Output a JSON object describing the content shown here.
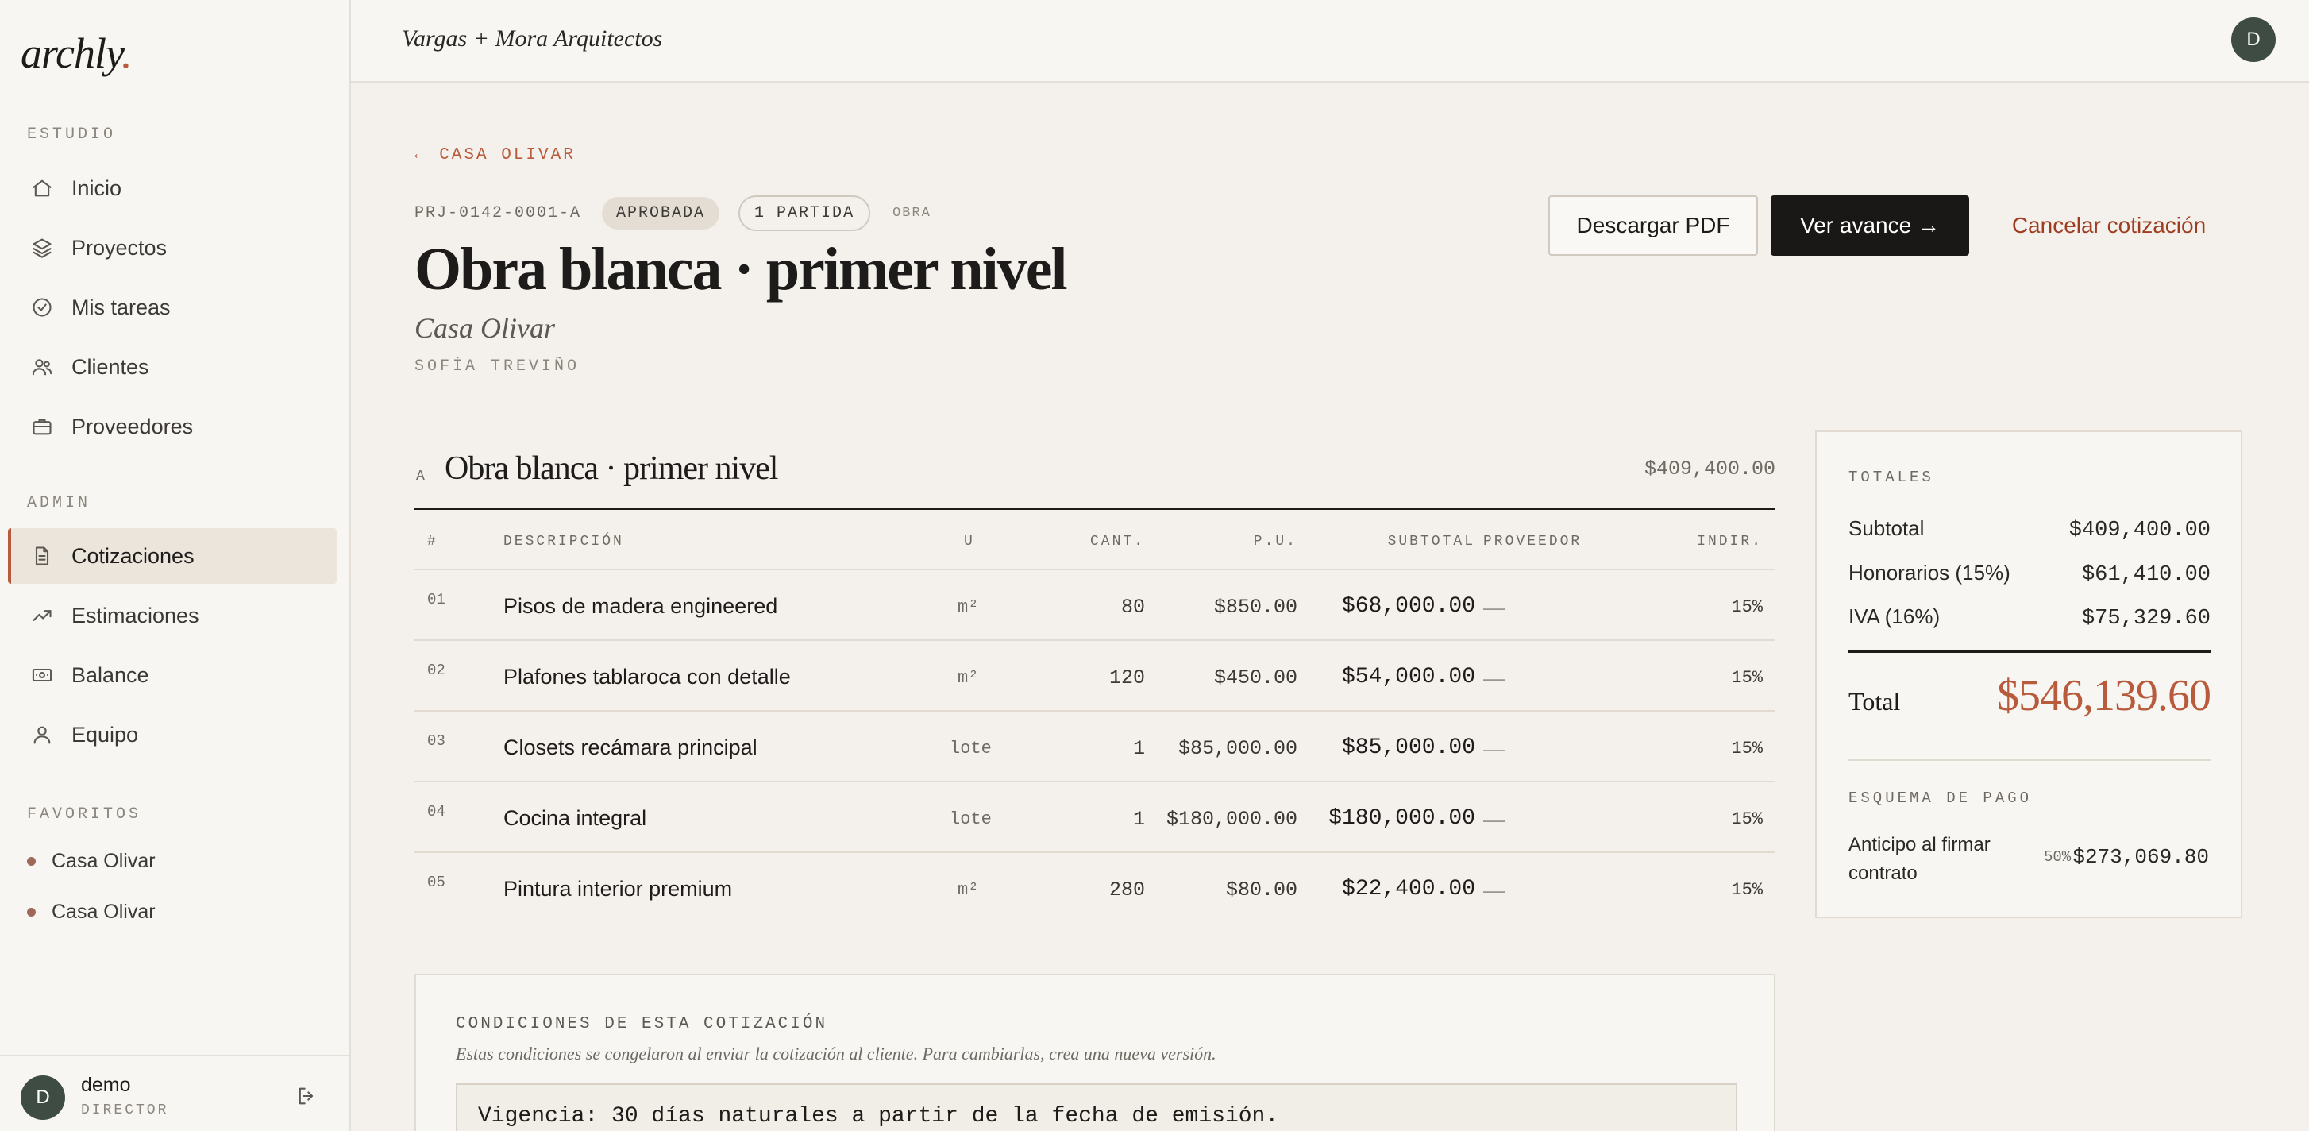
{
  "app": {
    "logo": "archly",
    "logo_dot": "."
  },
  "firm_name": "Vargas + Mora Arquitectos",
  "topbar_avatar": "D",
  "sidebar": {
    "sections": [
      {
        "label": "ESTUDIO",
        "items": [
          {
            "label": "Inicio",
            "icon": "home-icon"
          },
          {
            "label": "Proyectos",
            "icon": "layers-icon"
          },
          {
            "label": "Mis tareas",
            "icon": "check-circle-icon"
          },
          {
            "label": "Clientes",
            "icon": "users-icon"
          },
          {
            "label": "Proveedores",
            "icon": "briefcase-icon"
          }
        ]
      },
      {
        "label": "ADMIN",
        "items": [
          {
            "label": "Cotizaciones",
            "icon": "document-icon",
            "active": true
          },
          {
            "label": "Estimaciones",
            "icon": "trending-up-icon"
          },
          {
            "label": "Balance",
            "icon": "banknote-icon"
          },
          {
            "label": "Equipo",
            "icon": "user-icon"
          }
        ]
      },
      {
        "label": "FAVORITOS",
        "items": [
          {
            "label": "Casa Olivar"
          },
          {
            "label": "Casa Olivar"
          }
        ]
      }
    ],
    "user": {
      "initial": "D",
      "name": "demo",
      "role": "DIRECTOR"
    }
  },
  "header": {
    "back_label": "← CASA OLIVAR",
    "code": "PRJ-0142-0001-A",
    "status_badge": "APROBADA",
    "items_badge": "1 PARTIDA",
    "type": "OBRA",
    "title": "Obra blanca · primer nivel",
    "project": "Casa Olivar",
    "author": "SOFÍA TREVIÑO",
    "actions": {
      "download": "Descargar PDF",
      "progress": "Ver avance →",
      "cancel": "Cancelar cotización"
    }
  },
  "section": {
    "letter": "A",
    "title": "Obra blanca · primer nivel",
    "total": "$409,400.00"
  },
  "table": {
    "columns": [
      "#",
      "DESCRIPCIÓN",
      "U",
      "CANT.",
      "P.U.",
      "SUBTOTAL",
      "PROVEEDOR",
      "INDIR."
    ],
    "rows": [
      {
        "n": "01",
        "desc": "Pisos de madera engineered",
        "unit": "m²",
        "qty": "80",
        "pu": "$850.00",
        "subtotal": "$68,000.00",
        "supplier": "—",
        "indir": "15%"
      },
      {
        "n": "02",
        "desc": "Plafones tablaroca con detalle",
        "unit": "m²",
        "qty": "120",
        "pu": "$450.00",
        "subtotal": "$54,000.00",
        "supplier": "—",
        "indir": "15%"
      },
      {
        "n": "03",
        "desc": "Closets recámara principal",
        "unit": "lote",
        "qty": "1",
        "pu": "$85,000.00",
        "subtotal": "$85,000.00",
        "supplier": "—",
        "indir": "15%"
      },
      {
        "n": "04",
        "desc": "Cocina integral",
        "unit": "lote",
        "qty": "1",
        "pu": "$180,000.00",
        "subtotal": "$180,000.00",
        "supplier": "—",
        "indir": "15%"
      },
      {
        "n": "05",
        "desc": "Pintura interior premium",
        "unit": "m²",
        "qty": "280",
        "pu": "$80.00",
        "subtotal": "$22,400.00",
        "supplier": "—",
        "indir": "15%"
      }
    ]
  },
  "totals": {
    "heading": "TOTALES",
    "subtotal_label": "Subtotal",
    "subtotal": "$409,400.00",
    "fees_label": "Honorarios (15%)",
    "fees": "$61,410.00",
    "tax_label": "IVA (16%)",
    "tax": "$75,329.60",
    "total_label": "Total",
    "total": "$546,139.60",
    "payment_heading": "ESQUEMA DE PAGO",
    "payment_label": "Anticipo al firmar contrato",
    "payment_pct": "50%",
    "payment_value": "$273,069.80"
  },
  "conditions": {
    "heading": "CONDICIONES DE ESTA COTIZACIÓN",
    "note": "Estas condiciones se congelaron al enviar la cotización al cliente. Para cambiarlas, crea una nueva versión.",
    "text": "Vigencia: 30 días naturales a partir de la fecha de emisión."
  },
  "colors": {
    "accent": "#b85a3c",
    "danger_link": "#9e3d22",
    "avatar": "#3e4c44",
    "primary_button": "#1a1817",
    "background": "#f4f1ec"
  }
}
